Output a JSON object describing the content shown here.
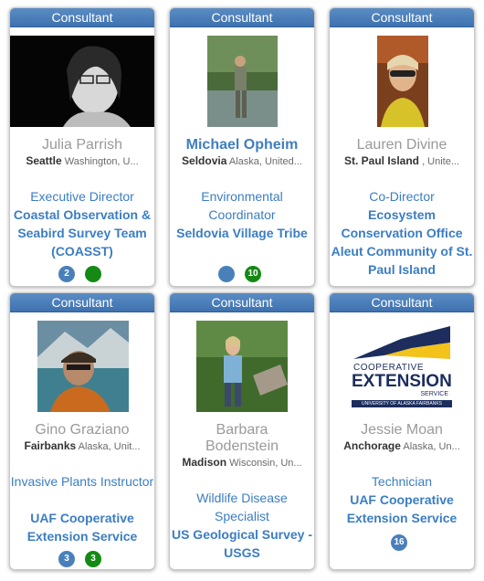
{
  "cards": [
    {
      "header": "Consultant",
      "name": "Julia Parrish",
      "location_city": "Seattle",
      "location_rest": "Washington, U...",
      "title": "Executive Director",
      "org": "Coastal Observation & Seabird Survey Team (COASST)",
      "badges": [
        "2",
        ""
      ]
    },
    {
      "header": "Consultant",
      "name": "Michael Opheim",
      "location_city": "Seldovia",
      "location_rest": "Alaska, United...",
      "title": "Environmental Coordinator",
      "org": "Seldovia Village Tribe",
      "badges": [
        "",
        "10"
      ]
    },
    {
      "header": "Consultant",
      "name": "Lauren Divine",
      "location_city": "St. Paul Island",
      "location_rest": ", Unite...",
      "title": "Co-Director",
      "org": "Ecosystem Conservation Office Aleut Community of St. Paul Island",
      "badges": []
    },
    {
      "header": "Consultant",
      "name": "Gino Graziano",
      "location_city": "Fairbanks",
      "location_rest": "Alaska, Unit...",
      "title": "Invasive Plants Instructor",
      "org": "UAF Cooperative Extension Service",
      "badges": [
        "3",
        "3"
      ]
    },
    {
      "header": "Consultant",
      "name": "Barbara Bodenstein",
      "location_city": "Madison",
      "location_rest": "Wisconsin, Un...",
      "title": "Wildlife Disease Specialist",
      "org": "US Geological Survey - USGS",
      "badges": []
    },
    {
      "header": "Consultant",
      "name": "Jessie Moan",
      "location_city": "Anchorage",
      "location_rest": "Alaska, Un...",
      "title": "Technician",
      "org": "UAF Cooperative Extension Service",
      "badges": [
        "16"
      ]
    }
  ],
  "logo": {
    "line1": "COOPERATIVE",
    "line2": "EXTENSION",
    "line3": "SERVICE",
    "line4": "UNIVERSITY OF ALASKA FAIRBANKS"
  },
  "colors": {
    "header_blue": "#4a80ba",
    "link_blue": "#3b7dc3",
    "badge_green": "#148a14"
  }
}
